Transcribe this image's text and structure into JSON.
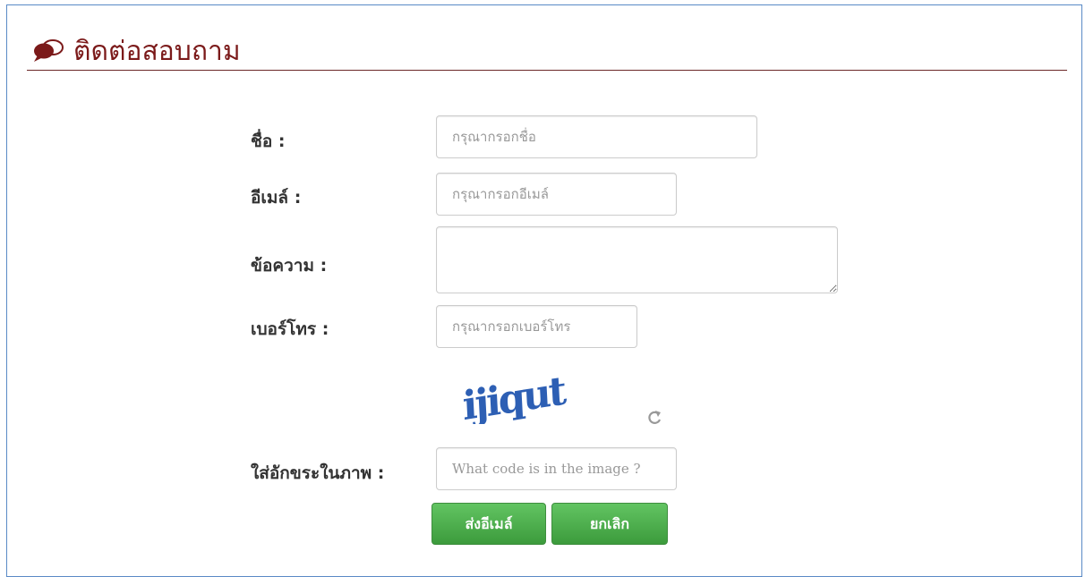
{
  "header": {
    "title": "ติดต่อสอบถาม",
    "icon": "speech-bubble-icon"
  },
  "form": {
    "name": {
      "label": "ชื่อ :",
      "placeholder": "กรุณากรอกชื่อ"
    },
    "email": {
      "label": "อีเมล์ :",
      "placeholder": "กรุณากรอกอีเมล์"
    },
    "message": {
      "label": "ข้อความ :",
      "placeholder": ""
    },
    "phone": {
      "label": "เบอร์โทร :",
      "placeholder": "กรุณากรอกเบอร์โทร"
    },
    "captcha": {
      "code": "ijiqut",
      "refresh_icon": "refresh-icon"
    },
    "captcha_input": {
      "label": "ใส่อักขระในภาพ :",
      "placeholder": "What code is in the image ?"
    },
    "buttons": {
      "submit": "ส่งอีเมล์",
      "cancel": "ยกเลิก"
    }
  },
  "colors": {
    "title": "#7b1a1a",
    "frame_border": "#5a8ac6",
    "button_green": "#47a447"
  }
}
